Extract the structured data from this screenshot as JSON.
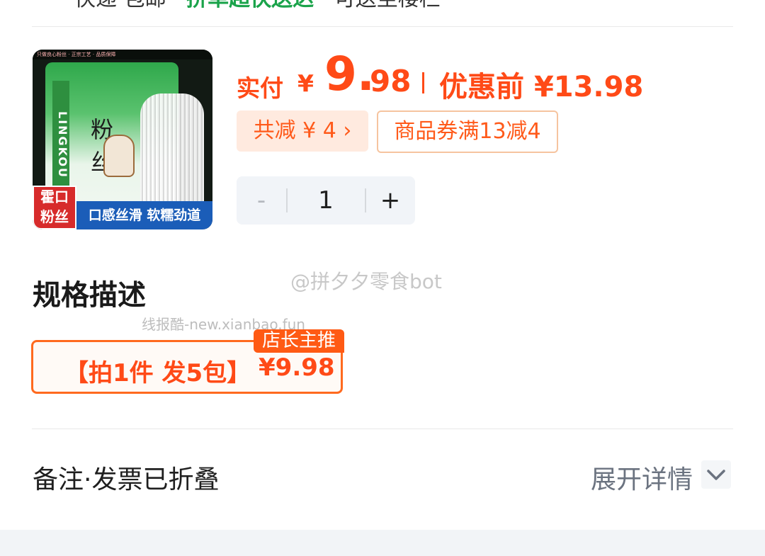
{
  "top_partial": {
    "text_before": "快递·包邮 · ",
    "text_green": "拼单超快送达",
    "text_after": " · 可送至楼栏"
  },
  "product": {
    "image": {
      "brand_badge_line1": "霍口",
      "brand_badge_line2": "粉丝",
      "slogan": "口感丝滑 软糯劲道",
      "package_strip": "LINGKOU",
      "package_char1": "粉",
      "package_char2": "丝",
      "top_banner": "只做良心粉丝 · 正宗工艺 · 品质保障"
    },
    "price": {
      "prefix": "实付",
      "yen": "¥",
      "integer": "9.",
      "decimal": "98",
      "original_label": "优惠前",
      "original_value": "¥13.98"
    },
    "discount_chip": "共减 ¥ 4 ›",
    "coupon_chip": "商品券满13减4",
    "stepper": {
      "minus": "-",
      "quantity": "1",
      "plus": "+"
    }
  },
  "spec_section": {
    "title": "规格描述",
    "option": {
      "label": "【拍1件 发5包】",
      "price": "¥9.98",
      "badge": "店长主推"
    }
  },
  "watermarks": {
    "weibo": "@拼夕夕零食bot",
    "site": "线报酷-new.xianbao.fun"
  },
  "remark": {
    "label": "备注·发票已折叠",
    "expand": "展开详情"
  },
  "colors": {
    "accent": "#ff4a17",
    "green": "#1aa34a",
    "stepper_bg": "#f1f4f8",
    "coupon_border": "#f6c49f"
  }
}
